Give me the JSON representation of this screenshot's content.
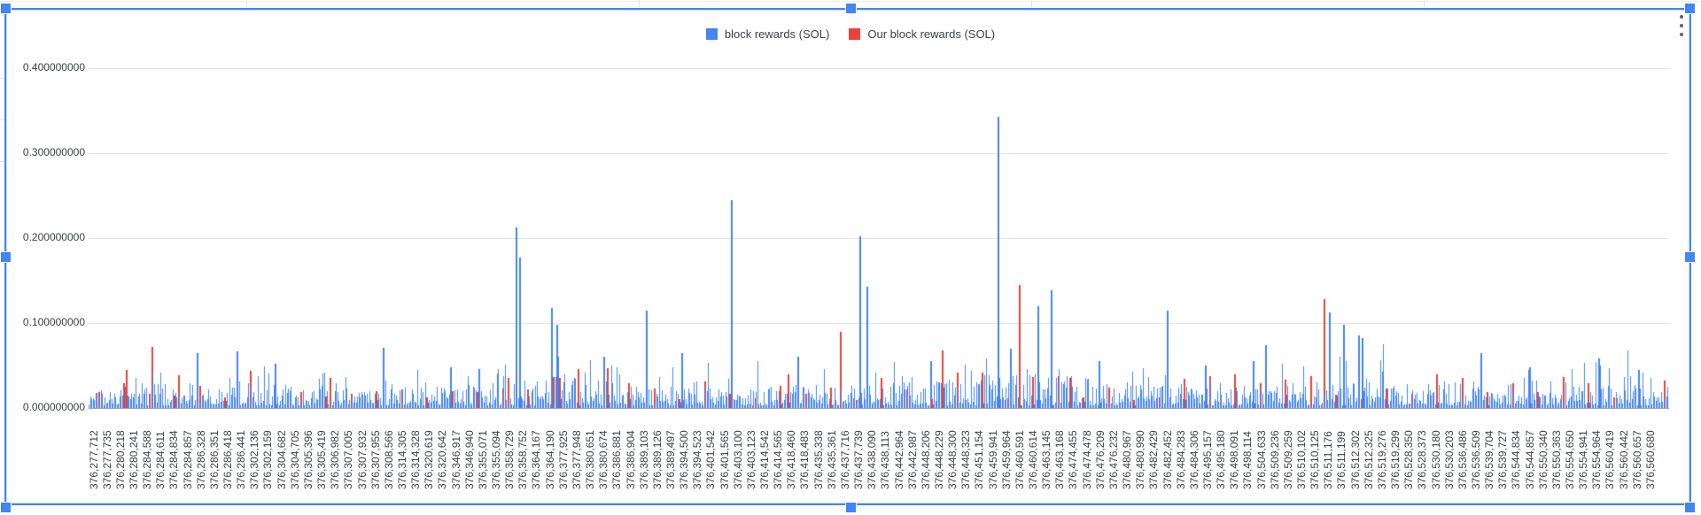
{
  "app": {
    "context": "spreadsheet-embedded-chart",
    "selection_border_color": "#4285f4",
    "handle_color": "#4285f4",
    "background_color": "#ffffff"
  },
  "menu": {
    "kebab_icon": "kebab-vertical-icon"
  },
  "legend": {
    "items": [
      {
        "label": "block rewards (SOL)",
        "color": "#4285f4"
      },
      {
        "label": "Our block rewards (SOL)",
        "color": "#ea4335"
      }
    ]
  },
  "chart_data": {
    "type": "bar",
    "title": "",
    "xlabel": "",
    "ylabel": "",
    "legend_position": "top-center",
    "grid": true,
    "series": [
      {
        "name": "block rewards (SOL)",
        "color": "#4285f4"
      },
      {
        "name": "Our block rewards (SOL)",
        "color": "#ea4335"
      }
    ],
    "y_axis": {
      "min": 0,
      "max": 0.45,
      "tick_values": [
        0,
        0.1,
        0.2,
        0.3,
        0.4
      ],
      "tick_labels": [
        "0.000000000",
        "0.100000000",
        "0.200000000",
        "0.300000000",
        "0.400000000"
      ],
      "grid_color": "#e4e4e6",
      "baseline_color": "#9aa0a6",
      "label_color": "#3c4043"
    },
    "x_axis": {
      "rotation": -90,
      "label_color": "#3c4043",
      "labels": [
        "376,277,712",
        "376,277,735",
        "376,280,218",
        "376,280,241",
        "376,284,588",
        "376,284,611",
        "376,284,834",
        "376,284,857",
        "376,286,328",
        "376,286,351",
        "376,286,418",
        "376,286,441",
        "376,302,136",
        "376,302,159",
        "376,304,682",
        "376,304,705",
        "376,305,396",
        "376,305,419",
        "376,306,982",
        "376,307,005",
        "376,307,932",
        "376,307,955",
        "376,308,566",
        "376,314,305",
        "376,314,328",
        "376,320,619",
        "376,320,642",
        "376,346,917",
        "376,346,940",
        "376,355,071",
        "376,355,094",
        "376,358,729",
        "376,358,752",
        "376,364,167",
        "376,364,190",
        "376,377,925",
        "376,377,948",
        "376,380,651",
        "376,380,674",
        "376,386,881",
        "376,386,904",
        "376,389,103",
        "376,389,126",
        "376,389,497",
        "376,394,500",
        "376,394,523",
        "376,401,542",
        "376,401,565",
        "376,403,100",
        "376,403,123",
        "376,414,542",
        "376,414,565",
        "376,418,460",
        "376,418,483",
        "376,435,338",
        "376,435,361",
        "376,437,716",
        "376,437,739",
        "376,438,090",
        "376,438,113",
        "376,442,964",
        "376,442,987",
        "376,448,206",
        "376,448,229",
        "376,448,300",
        "376,448,323",
        "376,451,154",
        "376,459,941",
        "376,459,964",
        "376,460,591",
        "376,460,614",
        "376,463,145",
        "376,463,168",
        "376,474,455",
        "376,474,478",
        "376,476,209",
        "376,476,232",
        "376,480,967",
        "376,480,990",
        "376,482,429",
        "376,482,452",
        "376,484,283",
        "376,484,306",
        "376,495,157",
        "376,495,180",
        "376,498,091",
        "376,498,114",
        "376,504,633",
        "376,509,236",
        "376,509,259",
        "376,510,102",
        "376,510,125",
        "376,511,176",
        "376,511,199",
        "376,512,302",
        "376,512,325",
        "376,519,276",
        "376,519,299",
        "376,528,350",
        "376,528,373",
        "376,530,180",
        "376,530,203",
        "376,536,486",
        "376,536,509",
        "376,539,704",
        "376,539,727",
        "376,544,834",
        "376,544,857",
        "376,550,340",
        "376,550,363",
        "376,554,650",
        "376,554,941",
        "376,554,964",
        "376,560,419",
        "376,560,442",
        "376,560,657",
        "376,560,680"
      ]
    },
    "prominent_bars": {
      "comment": "visually readable spikes as [x_fraction_of_plot, SOL value]",
      "blue": [
        [
          0.0684,
          0.065
        ],
        [
          0.0936,
          0.067
        ],
        [
          0.1177,
          0.052
        ],
        [
          0.1861,
          0.071
        ],
        [
          0.2287,
          0.048
        ],
        [
          0.2466,
          0.046
        ],
        [
          0.2702,
          0.213
        ],
        [
          0.2724,
          0.177
        ],
        [
          0.2931,
          0.118
        ],
        [
          0.2959,
          0.098
        ],
        [
          0.3251,
          0.06
        ],
        [
          0.352,
          0.115
        ],
        [
          0.3755,
          0.065
        ],
        [
          0.4064,
          0.245
        ],
        [
          0.4484,
          0.06
        ],
        [
          0.4882,
          0.202
        ],
        [
          0.4921,
          0.143
        ],
        [
          0.5325,
          0.055
        ],
        [
          0.5751,
          0.343
        ],
        [
          0.5829,
          0.07
        ],
        [
          0.6003,
          0.12
        ],
        [
          0.6093,
          0.139
        ],
        [
          0.639,
          0.055
        ],
        [
          0.6822,
          0.115
        ],
        [
          0.7063,
          0.05
        ],
        [
          0.7365,
          0.055
        ],
        [
          0.7444,
          0.074
        ],
        [
          0.7848,
          0.113
        ],
        [
          0.7943,
          0.098
        ],
        [
          0.8033,
          0.085
        ],
        [
          0.8055,
          0.082
        ],
        [
          0.8806,
          0.065
        ],
        [
          0.9114,
          0.048
        ],
        [
          0.9557,
          0.058
        ],
        [
          0.9809,
          0.045
        ]
      ],
      "red": [
        [
          0.0235,
          0.045
        ],
        [
          0.0398,
          0.072
        ],
        [
          0.0561,
          0.039
        ],
        [
          0.1519,
          0.035
        ],
        [
          0.2651,
          0.035
        ],
        [
          0.2976,
          0.035
        ],
        [
          0.3284,
          0.047
        ],
        [
          0.4428,
          0.04
        ],
        [
          0.4753,
          0.09
        ],
        [
          0.5398,
          0.068
        ],
        [
          0.5885,
          0.145
        ],
        [
          0.6205,
          0.035
        ],
        [
          0.7814,
          0.128
        ],
        [
          0.853,
          0.04
        ]
      ]
    },
    "bar_texture_spec": {
      "comment": "dense 1px-wide per-slot bars; procedural reconstruction parameters",
      "seed": 1337,
      "count": 1189,
      "base": 0.003,
      "rand_amp": 0.026,
      "tall_chance": 0.14,
      "tall_amp": 0.03,
      "huge_chance": 0.025,
      "huge_amp": 0.04,
      "noise_cap": 0.085,
      "red_interval": 19,
      "red_offset": 7,
      "red_base": 0.008,
      "red_amp": 0.03,
      "envelope": [
        [
          0.0,
          0.8
        ],
        [
          0.05,
          1.0
        ],
        [
          0.1,
          0.9
        ],
        [
          0.18,
          0.75
        ],
        [
          0.24,
          1.0
        ],
        [
          0.3,
          1.3
        ],
        [
          0.35,
          1.0
        ],
        [
          0.42,
          0.85
        ],
        [
          0.48,
          1.0
        ],
        [
          0.55,
          1.2
        ],
        [
          0.6,
          1.5
        ],
        [
          0.65,
          1.1
        ],
        [
          0.7,
          0.9
        ],
        [
          0.75,
          1.0
        ],
        [
          0.8,
          1.3
        ],
        [
          0.85,
          1.15
        ],
        [
          0.9,
          1.0
        ],
        [
          0.95,
          1.05
        ],
        [
          1.0,
          0.9
        ]
      ]
    }
  }
}
